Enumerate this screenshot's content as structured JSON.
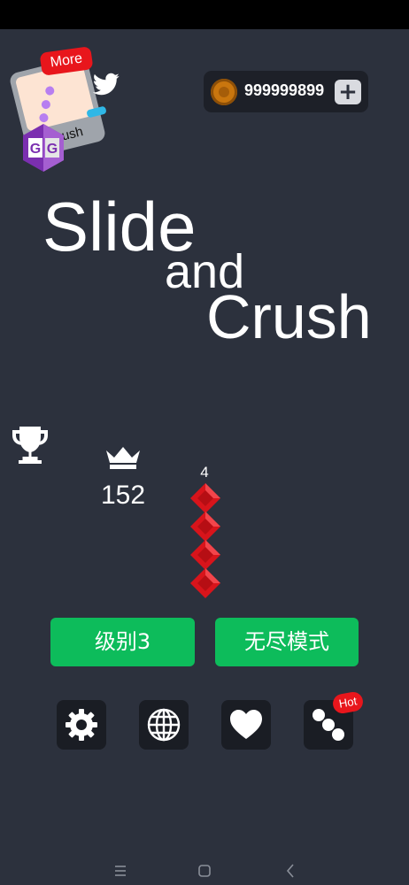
{
  "promo": {
    "more_label": "More",
    "game_name": "Crush",
    "gg_label": "GG"
  },
  "coins": {
    "amount": "999999899",
    "add_label": "+"
  },
  "title": {
    "line1": "Slide",
    "line2": "and",
    "line3": "Crush"
  },
  "stats": {
    "best_score": "152",
    "gem_count": "4"
  },
  "modes": {
    "level_label": "级别3",
    "endless_label": "无尽模式"
  },
  "toolbar": {
    "hot_badge": "Hot",
    "icons": [
      "gear-icon",
      "globe-icon",
      "heart-icon",
      "dots-icon"
    ]
  },
  "colors": {
    "background": "#2c313d",
    "button_green": "#0dbc5b",
    "gem_red": "#d8141b",
    "badge_red": "#e8161c",
    "coin_gold": "#c9760e"
  }
}
